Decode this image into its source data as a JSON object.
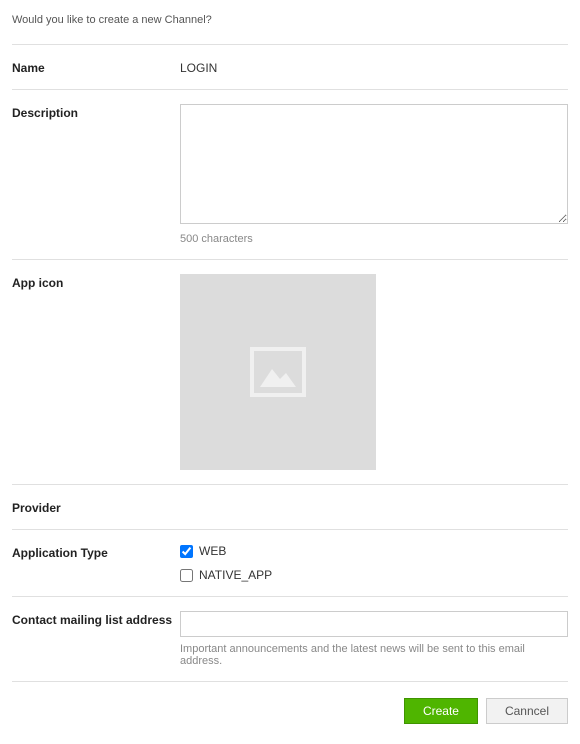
{
  "intro": "Would you like to create a new Channel?",
  "fields": {
    "name": {
      "label": "Name",
      "value": "LOGIN"
    },
    "description": {
      "label": "Description",
      "value": "",
      "hint": "500 characters"
    },
    "appIcon": {
      "label": "App icon"
    },
    "provider": {
      "label": "Provider",
      "value": ""
    },
    "appType": {
      "label": "Application Type",
      "options": [
        {
          "label": "WEB",
          "checked": true
        },
        {
          "label": "NATIVE_APP",
          "checked": false
        }
      ]
    },
    "contact": {
      "label": "Contact mailing list address",
      "value": "",
      "hint": "Important announcements and the latest news will be sent to this email address."
    }
  },
  "buttons": {
    "create": "Create",
    "cancel": "Canncel"
  }
}
